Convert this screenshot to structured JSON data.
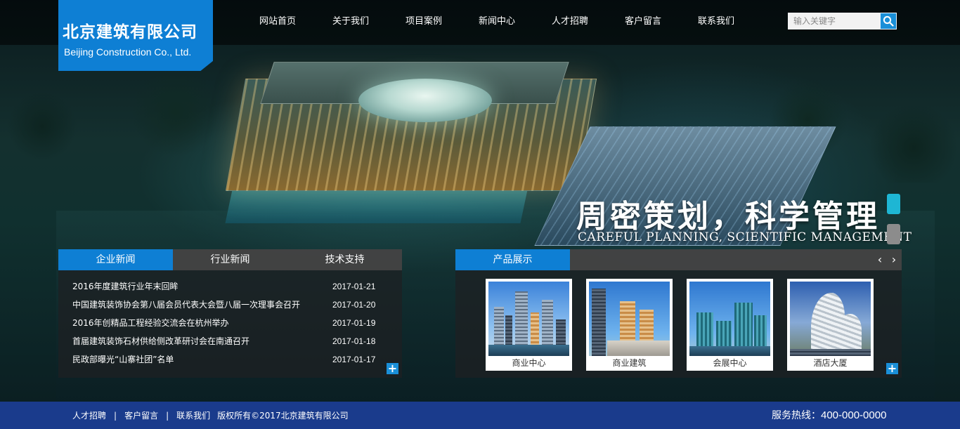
{
  "logo": {
    "name_cn": "北京建筑有限公司",
    "name_en": "Beijing Construction Co., Ltd.",
    "color": "#0e7fd4"
  },
  "nav": {
    "items": [
      "网站首页",
      "关于我们",
      "项目案例",
      "新闻中心",
      "人才招聘",
      "客户留言",
      "联系我们"
    ]
  },
  "search": {
    "placeholder": "输入关键字",
    "icon": "search-icon"
  },
  "banner": {
    "slogan_cn": "周密策划，科学管理",
    "slogan_en": "CAREFUL PLANNING, SCIENTIFIC MANAGEMENT",
    "slides": 2,
    "active_slide": 1,
    "dot_active_color": "#1eb6d4"
  },
  "news": {
    "tabs": [
      "企业新闻",
      "行业新闻",
      "技术支持"
    ],
    "active_tab": 0,
    "items": [
      {
        "title": "2016年度建筑行业年末回眸",
        "date": "2017-01-21"
      },
      {
        "title": "中国建筑装饰协会第八届会员代表大会暨八届一次理事会召开",
        "date": "2017-01-20"
      },
      {
        "title": "2016年创精品工程经验交流会在杭州举办",
        "date": "2017-01-19"
      },
      {
        "title": "首届建筑装饰石材供给侧改革研讨会在南通召开",
        "date": "2017-01-18"
      },
      {
        "title": "民政部曝光“山寨社团”名单",
        "date": "2017-01-17"
      }
    ],
    "more_label": "+"
  },
  "products": {
    "tab": "产品展示",
    "prev_label": "‹",
    "next_label": "›",
    "items": [
      {
        "name": "商业中心"
      },
      {
        "name": "商业建筑"
      },
      {
        "name": "会展中心"
      },
      {
        "name": "酒店大厦"
      }
    ],
    "more_label": "+"
  },
  "footer": {
    "links": [
      "人才招聘",
      "客户留言",
      "联系我们"
    ],
    "separator": "|",
    "copyright": "版权所有©2017北京建筑有限公司",
    "hotline_label": "服务热线：",
    "hotline_number": "400-000-0000",
    "background": "#1a3b8c"
  }
}
